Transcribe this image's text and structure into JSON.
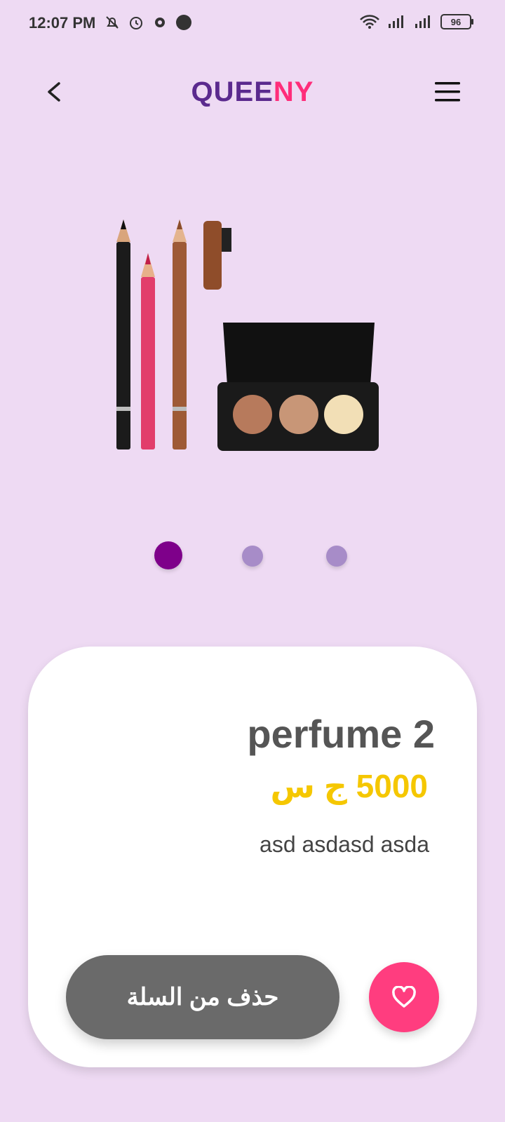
{
  "status_bar": {
    "time": "12:07 PM",
    "battery": "96",
    "icons_left": [
      "bell-off-icon",
      "alarm-icon",
      "gear-icon",
      "app-365-icon"
    ],
    "icons_right": [
      "wifi-icon",
      "signal-icon",
      "signal-icon",
      "battery-icon"
    ]
  },
  "header": {
    "logo_part1": "QUEE",
    "logo_part2": "NY",
    "logo_color1": "#5b2a8e",
    "logo_color2": "#ff2d7a",
    "back_icon": "chevron-left-icon",
    "menu_icon": "hamburger-menu-icon"
  },
  "carousel": {
    "total": 3,
    "active_index": 0,
    "active_color": "#7e008a",
    "inactive_color": "#a78cc8"
  },
  "product": {
    "name": "perfume 2",
    "price": "5000 ج س",
    "description": "asd asdasd  asda"
  },
  "actions": {
    "remove_label": "حذف من السلة",
    "favorite_icon": "heart-icon",
    "favorite_color": "#ff3d7f"
  }
}
